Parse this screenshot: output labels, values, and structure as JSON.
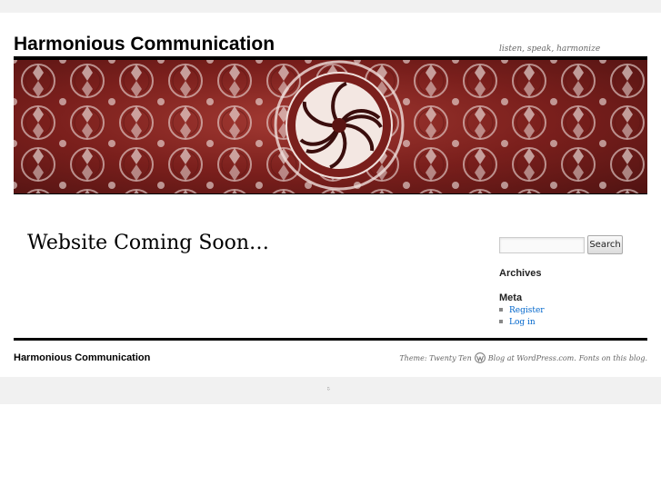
{
  "header": {
    "site_title": "Harmonious Communication",
    "tagline": "listen, speak, harmonize"
  },
  "content": {
    "title": "Website Coming Soon…"
  },
  "sidebar": {
    "search": {
      "placeholder": "",
      "button_label": "Search"
    },
    "archives_title": "Archives",
    "meta_title": "Meta",
    "meta_links": [
      "Register",
      "Log in"
    ]
  },
  "footer": {
    "site_title": "Harmonious Communication",
    "theme_text": "Theme: Twenty Ten",
    "blog_link": "Blog at WordPress.com.",
    "fonts_link": "Fonts on this blog."
  },
  "colors": {
    "link": "#0066cc",
    "rule": "#000000",
    "band": "#f1f1f1",
    "header_image_base": "#7a1f1c"
  },
  "icons": {
    "wordpress": "wordpress-logo-icon",
    "smiley": "smiley-icon",
    "list_bullet": "square-bullet-icon"
  }
}
